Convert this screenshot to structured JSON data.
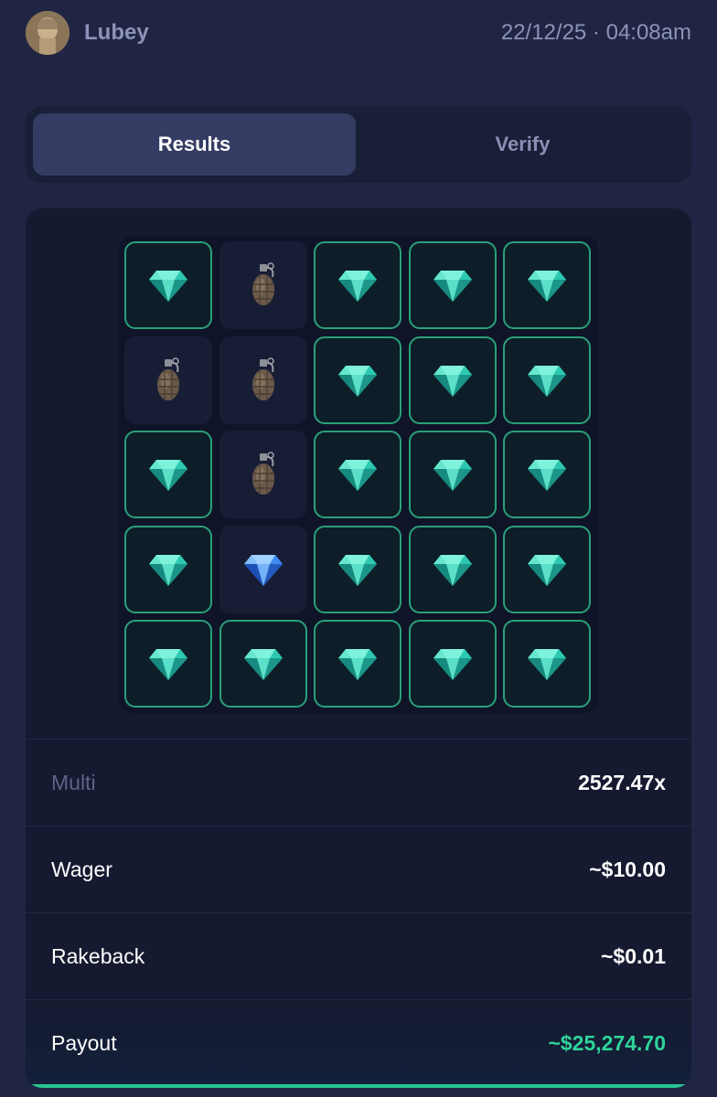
{
  "header": {
    "username": "Lubey",
    "timestamp": "22/12/25 · 04:08am",
    "avatar_icon": "avatar"
  },
  "tabs": [
    {
      "label": "Results",
      "active": true
    },
    {
      "label": "Verify",
      "active": false
    }
  ],
  "board": {
    "rows": 5,
    "cols": 5,
    "tiles": [
      [
        "gem",
        "mine",
        "gem",
        "gem",
        "gem"
      ],
      [
        "mine",
        "mine",
        "gem",
        "gem",
        "gem"
      ],
      [
        "gem",
        "mine",
        "gem",
        "gem",
        "gem"
      ],
      [
        "gem",
        "blue-gem",
        "gem",
        "gem",
        "gem"
      ],
      [
        "gem",
        "gem",
        "gem",
        "gem",
        "gem"
      ]
    ],
    "icons": {
      "gem": "teal-diamond-icon",
      "mine": "grenade-icon",
      "blue-gem": "blue-diamond-icon"
    },
    "colors": {
      "gem_border": "#2aa07a",
      "gem_fill": "#0d1e28",
      "unrevealed_fill": "#181d36"
    }
  },
  "stats": {
    "multi_label": "Multi",
    "multi_value": "2527.47x",
    "wager_label": "Wager",
    "wager_value": "~$10.00",
    "rakeback_label": "Rakeback",
    "rakeback_value": "~$0.01",
    "payout_label": "Payout",
    "payout_value": "~$25,274.70",
    "payout_color": "#2fd49a"
  }
}
